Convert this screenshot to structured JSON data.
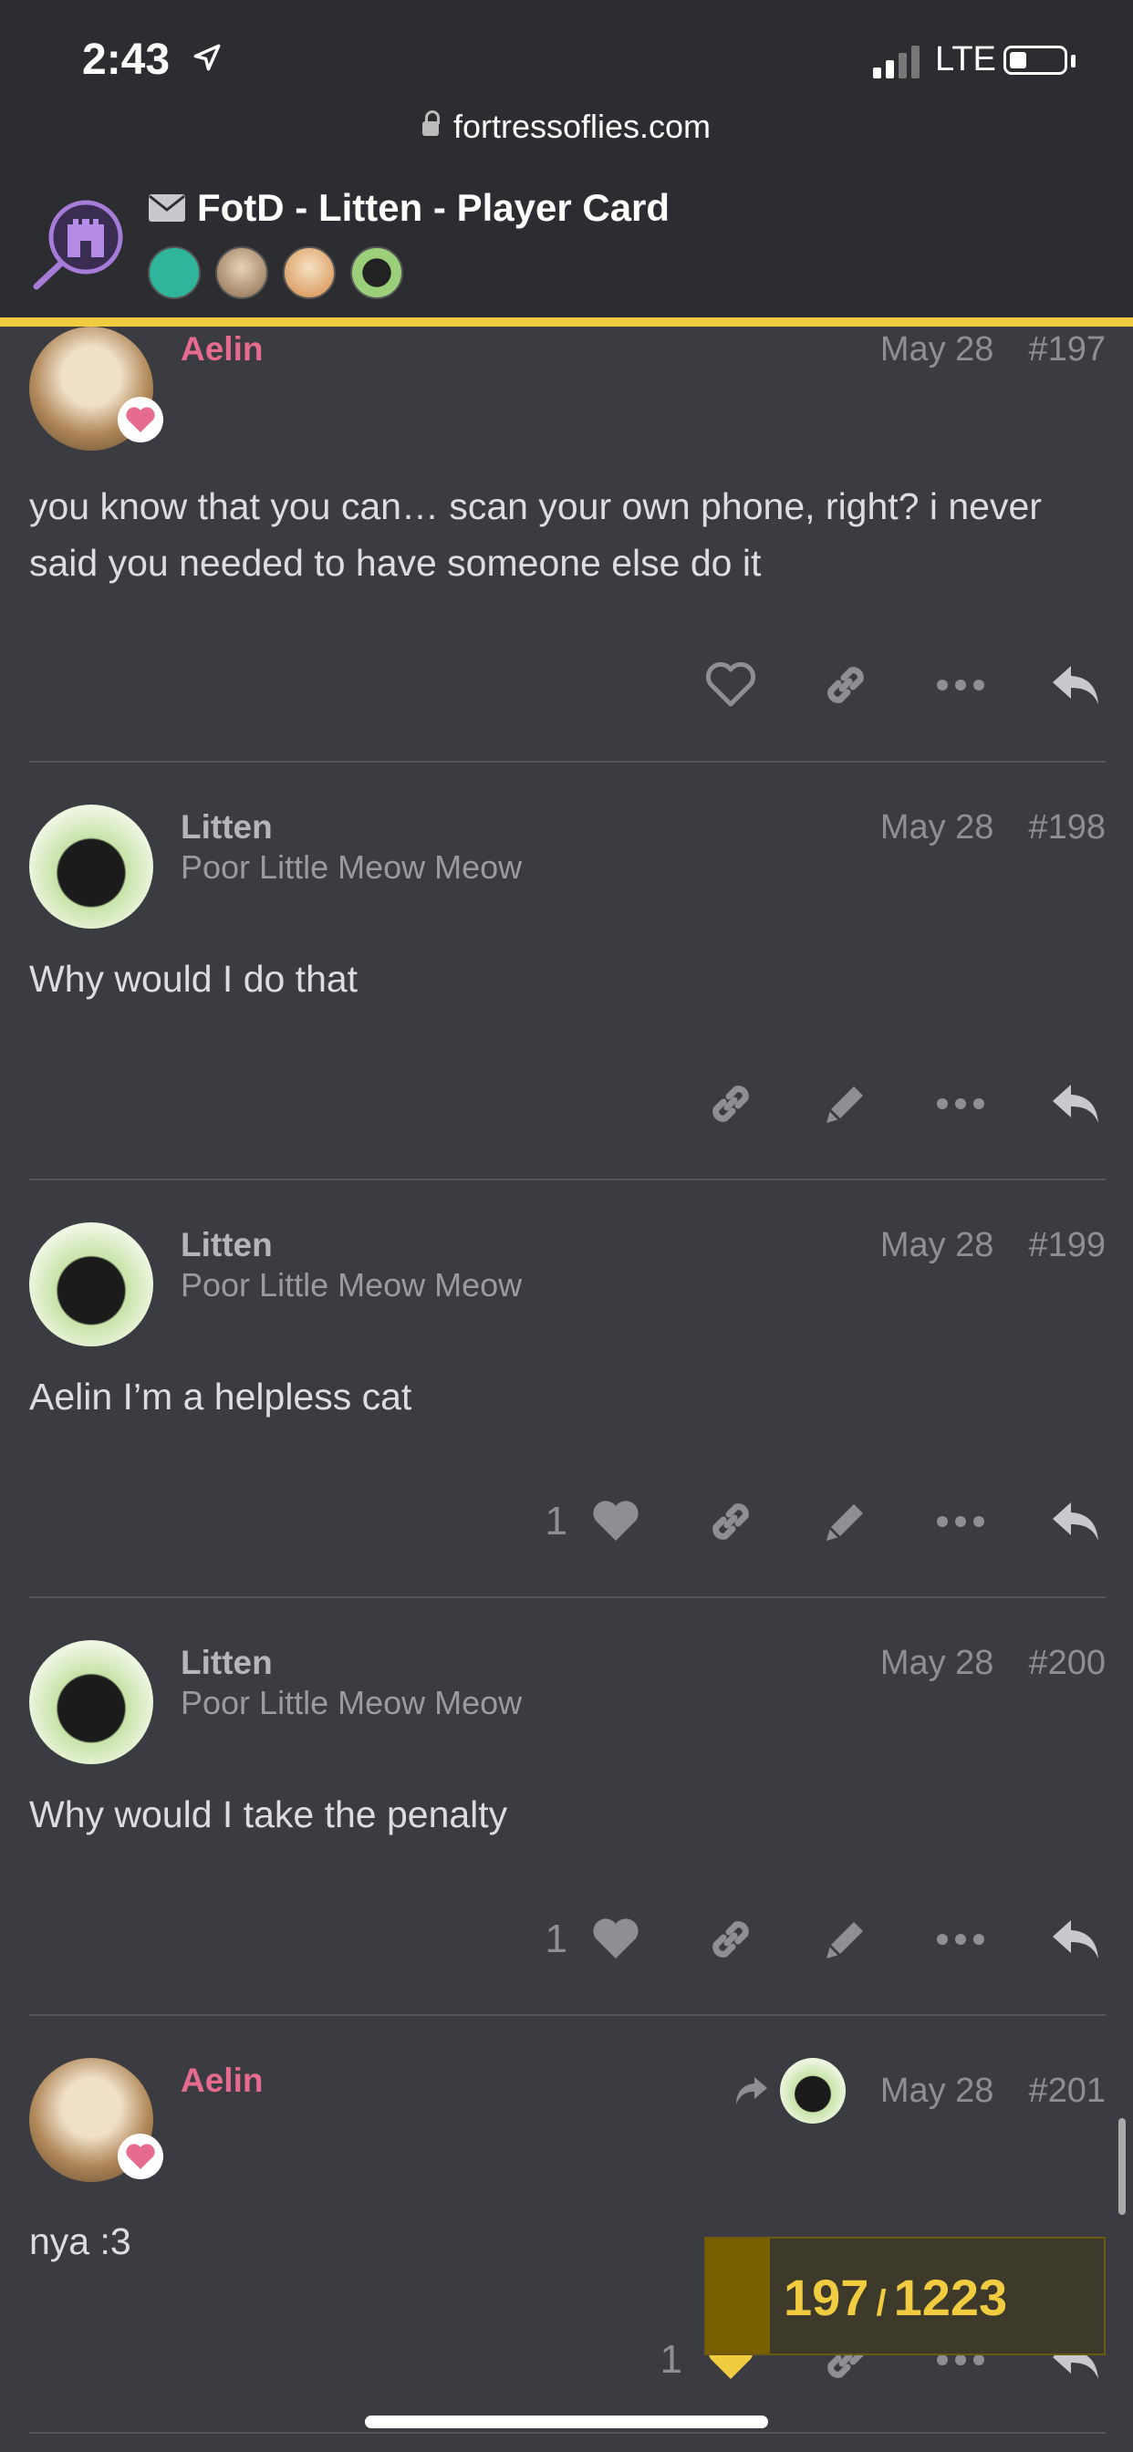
{
  "status": {
    "time": "2:43",
    "carrier": "LTE"
  },
  "browser": {
    "url": "fortressoflies.com"
  },
  "topic": {
    "title": "FotD - Litten - Player Card"
  },
  "posts": [
    {
      "username": "Aelin",
      "user_title": "",
      "date": "May 28",
      "number": "#197",
      "body": "you know that you can… scan your own phone, right? i never said you needed to have someone else do it",
      "likes": ""
    },
    {
      "username": "Litten",
      "user_title": "Poor Little Meow Meow",
      "date": "May 28",
      "number": "#198",
      "body": "Why would I do that",
      "likes": ""
    },
    {
      "username": "Litten",
      "user_title": "Poor Little Meow Meow",
      "date": "May 28",
      "number": "#199",
      "body": "Aelin I’m a helpless cat",
      "likes": "1"
    },
    {
      "username": "Litten",
      "user_title": "Poor Little Meow Meow",
      "date": "May 28",
      "number": "#200",
      "body": "Why would I take the penalty",
      "likes": "1"
    },
    {
      "username": "Aelin",
      "user_title": "",
      "date": "May 28",
      "number": "#201",
      "body": "nya :3",
      "likes": "1"
    }
  ],
  "progress": {
    "current": "197",
    "separator": "/",
    "total": "1223",
    "fraction": 0.161
  },
  "colors": {
    "accent": "#f1cb40",
    "aelin_name": "#e76a8f",
    "background": "#3a3c41"
  }
}
